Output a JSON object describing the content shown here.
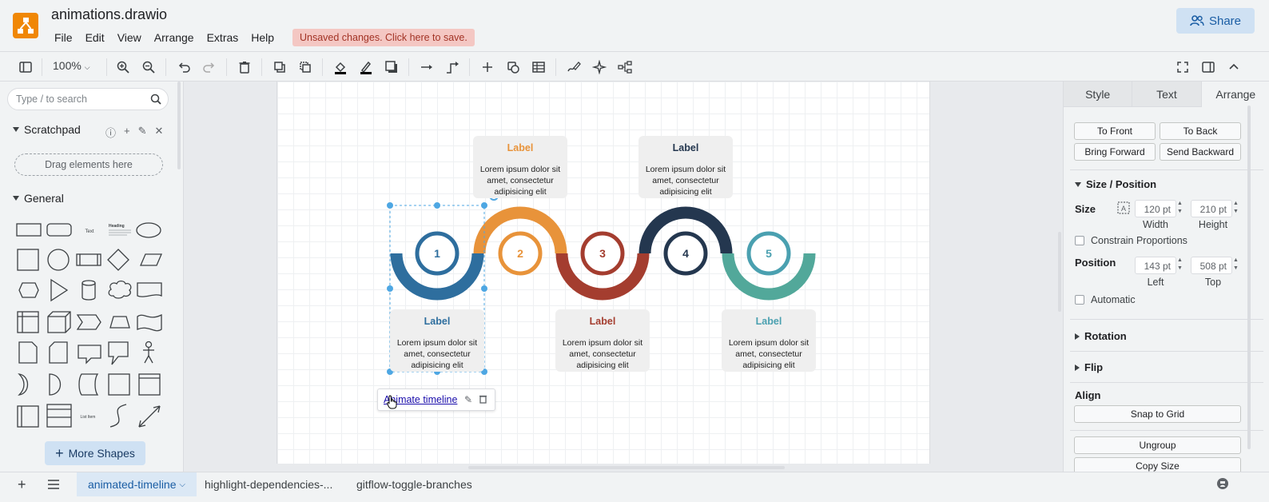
{
  "app": {
    "title": "animations.drawio"
  },
  "menu": [
    "File",
    "Edit",
    "View",
    "Arrange",
    "Extras",
    "Help"
  ],
  "unsaved_notice": "Unsaved changes. Click here to save.",
  "share_label": "Share",
  "toolbar": {
    "zoom": "100%"
  },
  "left": {
    "search_placeholder": "Type / to search",
    "scratchpad": "Scratchpad",
    "drag_here": "Drag elements here",
    "general": "General",
    "more_shapes": "More Shapes",
    "shape_text": "Text",
    "shape_heading": "Heading",
    "shape_list_item": "List Item"
  },
  "diagram": {
    "cards": [
      {
        "label": "Label",
        "text": "Lorem ipsum dolor sit amet, consectetur adipisicing elit",
        "color": "#e8933a"
      },
      {
        "label": "Label",
        "text": "Lorem ipsum dolor sit amet, consectetur adipisicing elit",
        "color": "#24374f"
      },
      {
        "label": "Label",
        "text": "Lorem ipsum dolor sit amet, consectetur adipisicing elit",
        "color": "#2e6e9e"
      },
      {
        "label": "Label",
        "text": "Lorem ipsum dolor sit amet, consectetur adipisicing elit",
        "color": "#a43d2f"
      },
      {
        "label": "Label",
        "text": "Lorem ipsum dolor sit amet, consectetur adipisicing elit",
        "color": "#4aa0b0"
      }
    ],
    "steps": [
      "1",
      "2",
      "3",
      "4",
      "5"
    ],
    "step_colors": [
      "#2e6e9e",
      "#e8933a",
      "#a43d2f",
      "#24374f",
      "#4aa0b0"
    ],
    "arc_colors": [
      "#2e6e9e",
      "#e8933a",
      "#a43d2f",
      "#24374f",
      "#52a89a"
    ],
    "link_text": "Animate timeline"
  },
  "right": {
    "tabs": [
      "Style",
      "Text",
      "Arrange"
    ],
    "to_front": "To Front",
    "to_back": "To Back",
    "bring_forward": "Bring Forward",
    "send_backward": "Send Backward",
    "size_position": "Size / Position",
    "size": "Size",
    "width_value": "120 pt",
    "height_value": "210 pt",
    "width_label": "Width",
    "height_label": "Height",
    "constrain": "Constrain Proportions",
    "position": "Position",
    "left_value": "143 pt",
    "top_value": "508 pt",
    "left_label": "Left",
    "top_label": "Top",
    "automatic": "Automatic",
    "rotation": "Rotation",
    "flip": "Flip",
    "align": "Align",
    "snap_to_grid": "Snap to Grid",
    "ungroup": "Ungroup",
    "copy_size": "Copy Size"
  },
  "footer": {
    "pages": [
      "animated-timeline",
      "highlight-dependencies-...",
      "gitflow-toggle-branches"
    ]
  }
}
